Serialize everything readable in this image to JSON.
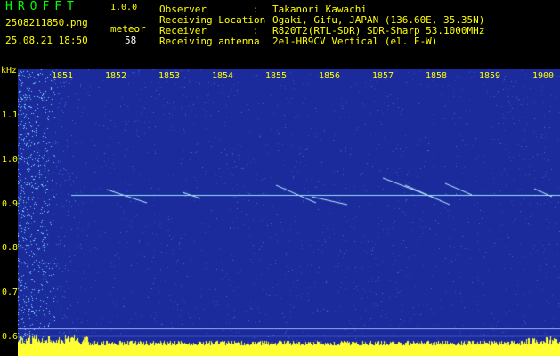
{
  "app": {
    "title": "HROFFT",
    "version": "1.0.0"
  },
  "file": {
    "name": "2508211850.png",
    "timestamp": "25.08.21 18:50"
  },
  "count": {
    "type": "meteor",
    "value": "58"
  },
  "info": [
    {
      "label": "Observer",
      "value": "Takanori Kawachi"
    },
    {
      "label": "Receiving Location",
      "value": "Ogaki, Gifu, JAPAN (136.60E, 35.35N)"
    },
    {
      "label": "Receiver",
      "value": "R820T2(RTL-SDR) SDR-Sharp 53.1000MHz"
    },
    {
      "label": "Receiving antenna",
      "value": "2el-HB9CV Vertical (el. E-W)"
    }
  ],
  "y_axis": {
    "unit": "kHz",
    "ticks": [
      "1.1",
      "1.0",
      "0.9",
      "0.8",
      "0.7",
      "0.6"
    ]
  },
  "x_axis": {
    "ticks": [
      "1851",
      "1852",
      "1853",
      "1854",
      "1855",
      "1856",
      "1857",
      "1858",
      "1859",
      "1900"
    ]
  },
  "colors": {
    "text": "#ffff00",
    "title": "#00ff00",
    "background": "#000000",
    "spectrum": "#1a2a9a"
  }
}
